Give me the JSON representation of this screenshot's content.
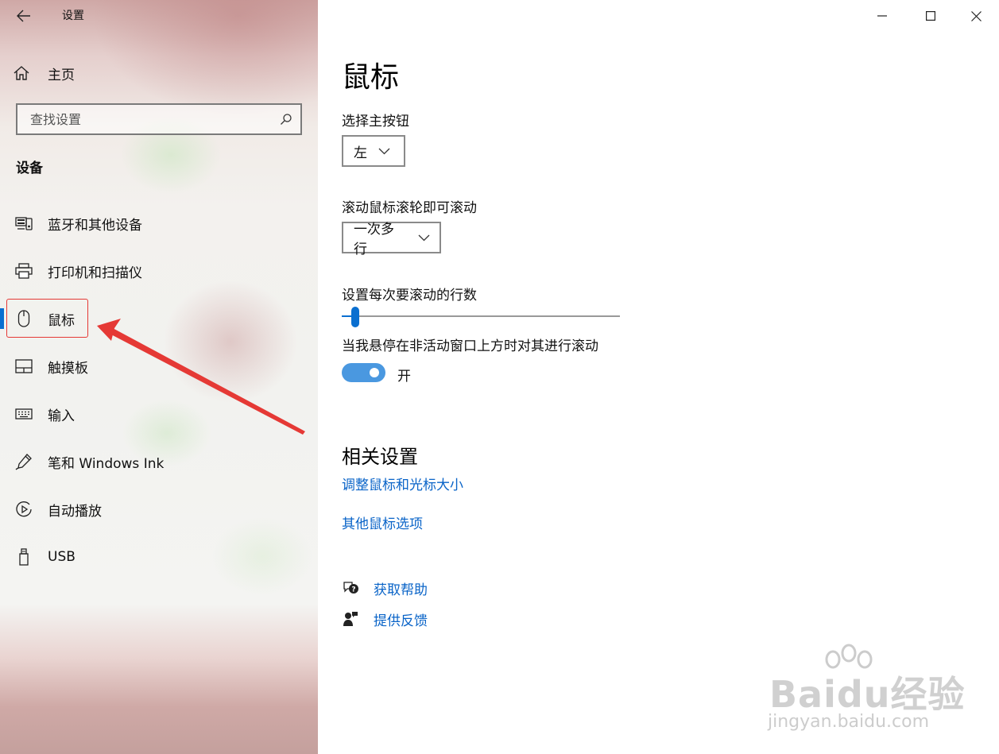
{
  "window": {
    "title": "设置",
    "controls": {
      "minimize": "minimize-icon",
      "maximize": "maximize-icon",
      "close": "close-icon"
    }
  },
  "sidebar": {
    "home": {
      "label": "主页",
      "icon": "home-icon"
    },
    "search": {
      "placeholder": "查找设置",
      "value": "",
      "icon": "search-icon"
    },
    "section": "设备",
    "items": [
      {
        "label": "蓝牙和其他设备",
        "icon": "bluetooth-devices-icon"
      },
      {
        "label": "打印机和扫描仪",
        "icon": "printer-icon"
      },
      {
        "label": "鼠标",
        "icon": "mouse-icon",
        "selected": true
      },
      {
        "label": "触摸板",
        "icon": "touchpad-icon"
      },
      {
        "label": "输入",
        "icon": "keyboard-icon"
      },
      {
        "label": "笔和 Windows Ink",
        "icon": "pen-icon"
      },
      {
        "label": "自动播放",
        "icon": "autoplay-icon"
      },
      {
        "label": "USB",
        "icon": "usb-icon"
      }
    ]
  },
  "main": {
    "title": "鼠标",
    "primary_button": {
      "label": "选择主按钮",
      "value": "左"
    },
    "wheel_scroll": {
      "label": "滚动鼠标滚轮即可滚动",
      "value": "一次多行"
    },
    "scroll_lines": {
      "label": "设置每次要滚动的行数",
      "fraction": 0.03
    },
    "inactive_scroll": {
      "label": "当我悬停在非活动窗口上方时对其进行滚动",
      "state": "开",
      "on": true
    },
    "related": {
      "title": "相关设置",
      "links": [
        "调整鼠标和光标大小",
        "其他鼠标选项"
      ]
    },
    "help": {
      "get_help": {
        "label": "获取帮助",
        "icon": "help-chat-icon"
      },
      "feedback": {
        "label": "提供反馈",
        "icon": "feedback-icon"
      }
    }
  },
  "annotation": {
    "color": "#e53935"
  },
  "watermark": {
    "brand": "Baidu经验",
    "url": "jingyan.baidu.com"
  },
  "colors": {
    "accent": "#0a6fd0",
    "link": "#0a64c8",
    "toggle_on": "#4a98e0"
  }
}
